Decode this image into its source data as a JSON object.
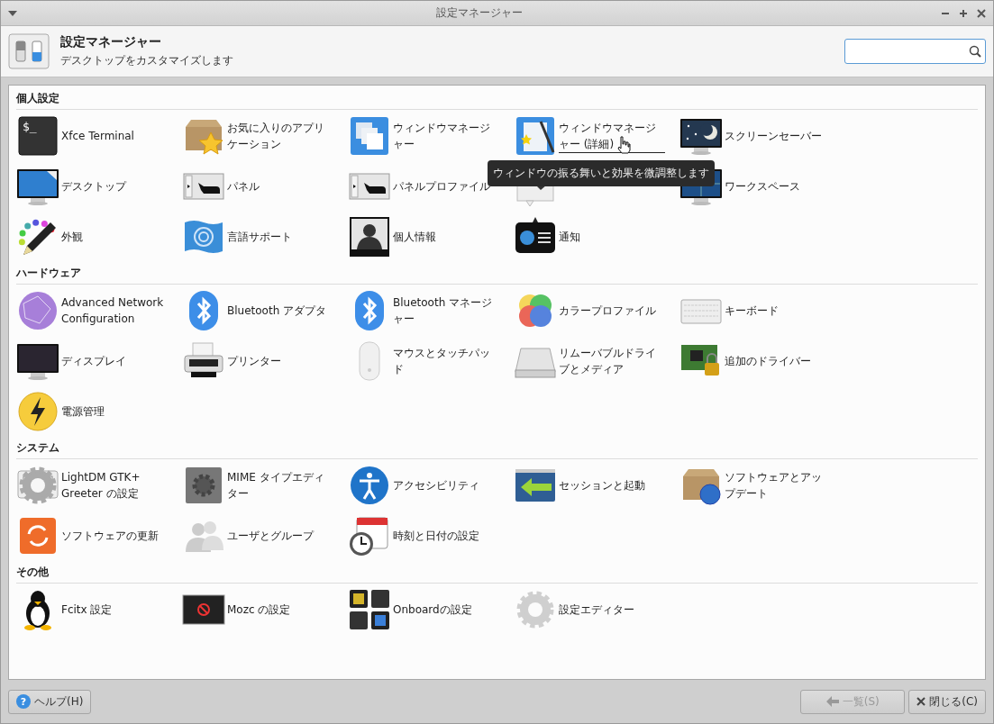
{
  "window": {
    "title": "設定マネージャー"
  },
  "header": {
    "title": "設定マネージャー",
    "subtitle": "デスクトップをカスタマイズします"
  },
  "sections": [
    {
      "title": "個人設定",
      "items": [
        {
          "label": "Xfce Terminal",
          "glyph": "$_"
        },
        {
          "label": "お気に入りのアプリケーション"
        },
        {
          "label": "ウィンドウマネージャー"
        },
        {
          "label": "ウィンドウマネージャー (詳細)",
          "hovered": true
        },
        {
          "label": "スクリーンセーバー"
        },
        {
          "label": "デスクトップ"
        },
        {
          "label": "パネル"
        },
        {
          "label": "パネルプロファイル"
        },
        {
          "kind": "icon"
        },
        {
          "label": "ワークスペース"
        },
        {
          "label": "外観"
        },
        {
          "label": "言語サポート"
        },
        {
          "label": "個人情報"
        },
        {
          "label": "通知"
        }
      ]
    },
    {
      "title": "ハードウェア",
      "items": [
        {
          "label": "Advanced Network Configuration"
        },
        {
          "label": "Bluetooth アダプタ"
        },
        {
          "label": "Bluetooth マネージャー"
        },
        {
          "label": "カラープロファイル"
        },
        {
          "label": "キーボード"
        },
        {
          "label": "ディスプレイ"
        },
        {
          "label": "プリンター"
        },
        {
          "label": "マウスとタッチパッド"
        },
        {
          "label": "リムーバブルドライブとメディア"
        },
        {
          "label": "追加のドライバー"
        },
        {
          "label": "電源管理"
        }
      ]
    },
    {
      "title": "システム",
      "items": [
        {
          "label": "LightDM GTK+ Greeter の設定"
        },
        {
          "label": "MIME タイプエディター"
        },
        {
          "label": "アクセシビリティ"
        },
        {
          "label": "セッションと起動"
        },
        {
          "label": "ソフトウェアとアップデート"
        },
        {
          "label": "ソフトウェアの更新"
        },
        {
          "label": "ユーザとグループ"
        },
        {
          "label": "時刻と日付の設定"
        }
      ]
    },
    {
      "title": "その他",
      "items": [
        {
          "label": "Fcitx 設定"
        },
        {
          "label": "Mozc の設定"
        },
        {
          "label": "Onboardの設定"
        },
        {
          "label": "設定エディター"
        }
      ]
    }
  ],
  "tooltip": {
    "text": "ウィンドウの振る舞いと効果を微調整します"
  },
  "footer": {
    "help": {
      "label": "ヘルプ(H)",
      "glyph": "?"
    },
    "buttons": [
      {
        "label": "一覧(S)",
        "disabled": true
      },
      {
        "label": "閉じる(C)",
        "disabled": false
      }
    ]
  }
}
